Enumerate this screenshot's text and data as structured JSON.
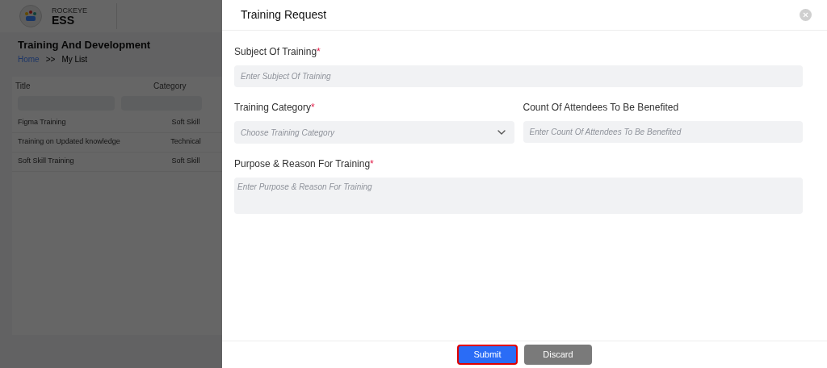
{
  "app": {
    "brand_top": "ROCKEYE",
    "brand_bottom": "ESS"
  },
  "page": {
    "title": "Training And Development",
    "breadcrumb": [
      {
        "label": "Home",
        "link": true
      },
      {
        "label": ">>",
        "link": false
      },
      {
        "label": "My List",
        "link": false
      }
    ]
  },
  "table": {
    "columns": [
      "Title",
      "Category"
    ],
    "rows": [
      [
        "Figma Training",
        "Soft Skill"
      ],
      [
        "Training on Updated knowledge",
        "Technical"
      ],
      [
        "Soft Skill Training",
        "Soft Skill"
      ]
    ]
  },
  "modal": {
    "title": "Training Request",
    "field_rows": [
      [
        {
          "kind": "input",
          "label": "Subject Of Training",
          "required_mark": "*",
          "placeholder": "Enter Subject Of Training"
        }
      ],
      [
        {
          "kind": "select",
          "label": "Training Category",
          "required_mark": "*",
          "placeholder": "Choose Training Category"
        },
        {
          "kind": "input",
          "label": "Count Of Attendees To Be Benefited",
          "placeholder": "Enter Count Of Attendees To Be Benefited"
        }
      ],
      [
        {
          "kind": "textarea",
          "label": "Purpose & Reason For Training",
          "required_mark": "*",
          "placeholder": "Enter Purpose & Reason For Training"
        }
      ]
    ],
    "buttons": [
      {
        "label": "Submit",
        "kind": "primary",
        "highlighted": true
      },
      {
        "label": "Discard",
        "kind": "secondary",
        "highlighted": false
      }
    ]
  }
}
